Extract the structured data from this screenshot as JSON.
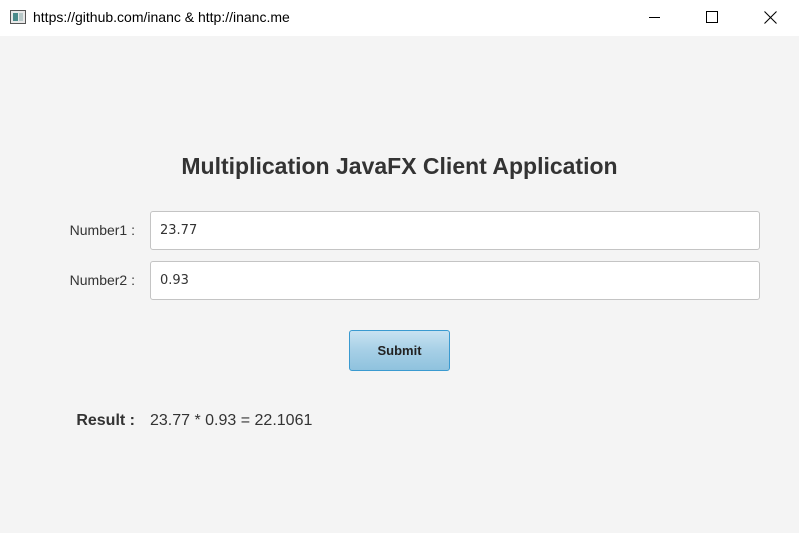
{
  "window": {
    "title": "https://github.com/inanc & http://inanc.me",
    "icon": "java-app-icon",
    "controls": [
      "minimize-icon",
      "maximize-icon",
      "close-icon"
    ]
  },
  "form": {
    "heading": "Multiplication JavaFX Client Application",
    "number1": {
      "label": "Number1 :",
      "value": "23.77"
    },
    "number2": {
      "label": "Number2 :",
      "value": "0.93"
    },
    "submit_label": "Submit",
    "result": {
      "label": "Result :",
      "value": "23.77 * 0.93 = 22.1061"
    }
  },
  "colors": {
    "background": "#f4f4f4",
    "button_border": "#3a9ad0",
    "button_fill": "#a6cfe6",
    "text": "#333333"
  }
}
